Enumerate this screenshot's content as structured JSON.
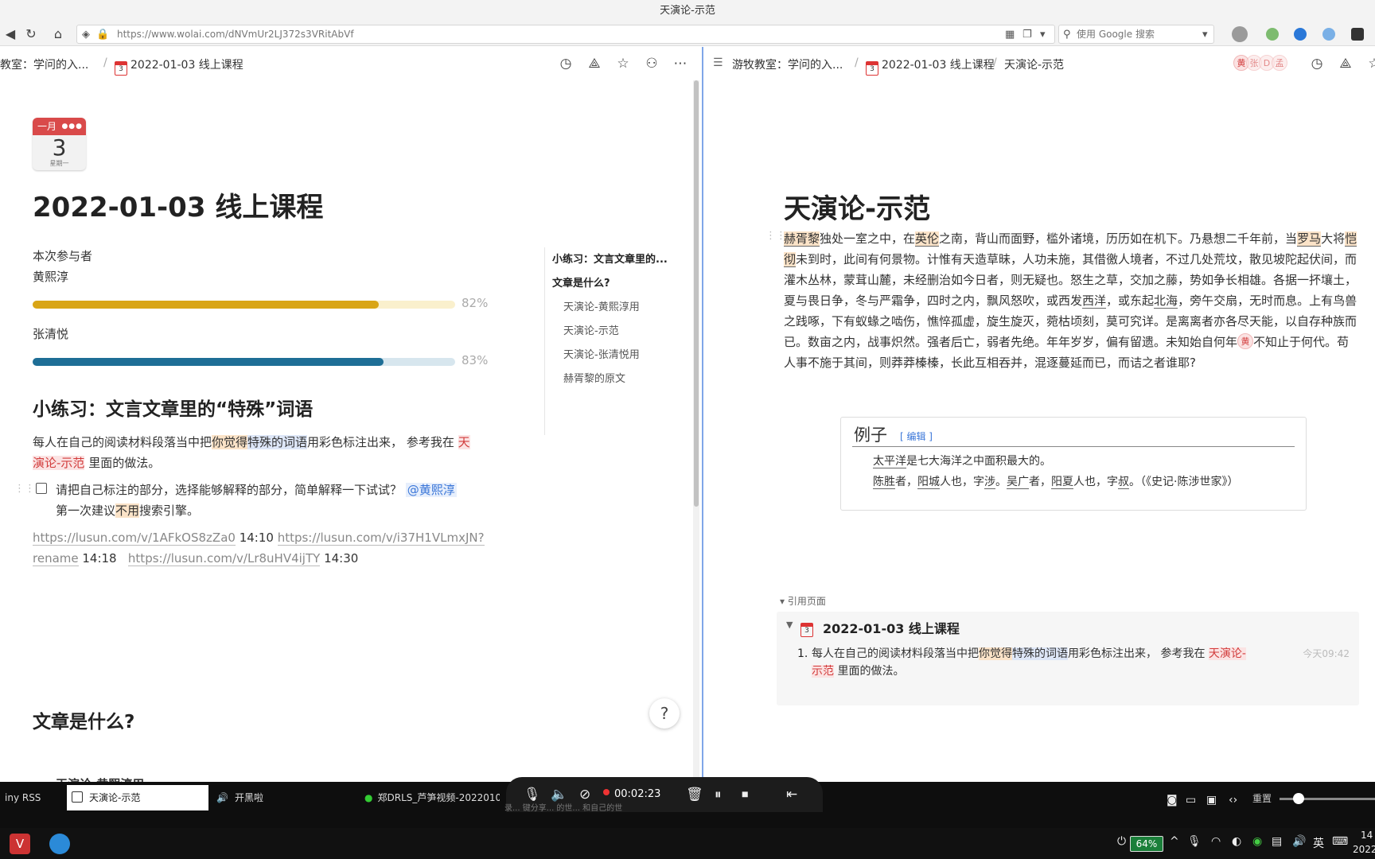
{
  "window": {
    "title": "天演论-示范"
  },
  "browser": {
    "url": "https://www.wolai.com/dNVmUr2LJ372s3VRitAbVf",
    "search_placeholder": "使用 Google 搜索"
  },
  "left": {
    "breadcrumb": [
      "教室：学问的入...",
      "2022-01-03 线上课程"
    ],
    "calendar": {
      "month": "一月",
      "day": "3",
      "weekday": "星期一"
    },
    "page_title": "2022-01-03 线上课程",
    "participants_label": "本次参与者",
    "participants": [
      {
        "name": "黄熙淳",
        "percent": 82,
        "percent_label": "82%",
        "color": "#d9a516",
        "track": "#faf0cd"
      },
      {
        "name": "张清悦",
        "percent": 83,
        "percent_label": "83%",
        "color": "#1e6e96",
        "track": "#d7e6ee"
      }
    ],
    "exercise_heading": "小练习：文言文章里的“特殊”词语",
    "para": {
      "p1": "每人在自己的阅读材料段落当中把",
      "hl1": "你觉得",
      "hl2": "特殊的词语",
      "p2": "用彩色标注出来，  参考我在 ",
      "link1": "天",
      "link2": "演论-示范",
      "p3": " 里面的做法。"
    },
    "todo": {
      "t1": "请把自己标注的部分，选择能够解释的部分，简单解释一下试试？ ",
      "mention": "@黄熙淳",
      "t2a": "第一次建议",
      "t2hl": "不用",
      "t2b": "搜索引擎。"
    },
    "links": {
      "u1": "https://lusun.com/v/1AFkOS8zZa0",
      "t1": " 14:10 ",
      "u2a": "https://lusun.com/v/i37H1VLmxJN?",
      "u2b": "rename",
      "t2": " 14:18 ",
      "u3": "https://lusun.com/v/Lr8uHV4ijTY",
      "t3": "  14:30"
    },
    "section2": "文章是什么?",
    "cut_item": "天演论-黄熙淳用",
    "toc": [
      "小练习：文言文章里的...",
      "文章是什么?",
      "天演论-黄熙淳用",
      "天演论-示范",
      "天演论-张清悦用",
      "赫胥黎的原文"
    ]
  },
  "right": {
    "breadcrumb": [
      "游牧教室：学问的入...",
      "2022-01-03 线上课程",
      "天演论-示范"
    ],
    "avatars": [
      "黄",
      "张",
      "D",
      "孟"
    ],
    "page_title": "天演论-示范",
    "article": {
      "a1": "赫胥黎",
      "a2": "独处一室之中，在",
      "a3": "英伦",
      "a4": "之南，背山而面野，槛外诸境，历历如在机下。乃悬想二千年前，当",
      "a5": "罗马",
      "a6": "大将",
      "a7": "恺彻",
      "a8": "未到时，此间有何景物。计惟有天造草昧，人功未施，其借徼人境者，不过几处荒坟，散见坡陀起伏间，而灌木丛林，蒙茸山麓，未经删治如今日者，则无疑也。怒生之草，交加之藤，势如争长相雄。各据一抔壤土，夏与畏日争，冬与严霜争，四时之内，飘风怒吹，或西发",
      "a9": "西洋",
      "a10": "，或东起",
      "a11": "北海",
      "a12": "，旁午交扇，无时而息。上有鸟兽之践啄，下有蚁蝝之啮伤，憔悴孤虚，旋生旋灭，菀枯顷刻，莫可究详。是离离者亦各尽天能，以自存种族而已。数亩之内，战事炽然。强者后亡，弱者先绝。年年岁岁，偏有留遗。未知始自何年",
      "badge": "黄",
      "a13": "不知止于何代。苟人事不施于其间，则莽莽榛榛，长此互相吞并，混逐蔓延而已，而诘之者谁耶?"
    },
    "example": {
      "title": "例子",
      "edit": "[ 编辑 ]",
      "line1": {
        "a": "太平洋",
        "b": "是七大海洋之中面积最大的。"
      },
      "line2": {
        "a": "陈胜",
        "b": "者，",
        "c": "阳城",
        "d": "人也，字",
        "e": "涉",
        "f": "。",
        "g": "吴广",
        "h": "者，",
        "i": "阳夏",
        "j": "人也，字",
        "k": "叔",
        "l": "。（《史记·陈涉世家》）"
      }
    },
    "refs_label": "▾ 引用页面",
    "ref": {
      "title": "2022-01-03 线上课程",
      "num": "1.",
      "p1": "每人在自己的阅读材料段落当中把",
      "hl1": "你觉得",
      "hl2": "特殊的词语",
      "p2": "用彩色标注出来，  参考我在 ",
      "link": "天演论-示范",
      "p3": " 里面的做法。",
      "time": "今天09:42"
    }
  },
  "taskbar": {
    "tabs": [
      "iny RSS",
      "天演论-示范",
      "开黑啦",
      "郑DRLS_芦笋视频-2022010"
    ],
    "recording_time": "00:02:23",
    "recording_hint": "录... 键分享... 的世... 和自己的世",
    "reset_label": "重置",
    "battery": "64%",
    "ime": "英",
    "clock_time": "14",
    "clock_date": "2022"
  }
}
